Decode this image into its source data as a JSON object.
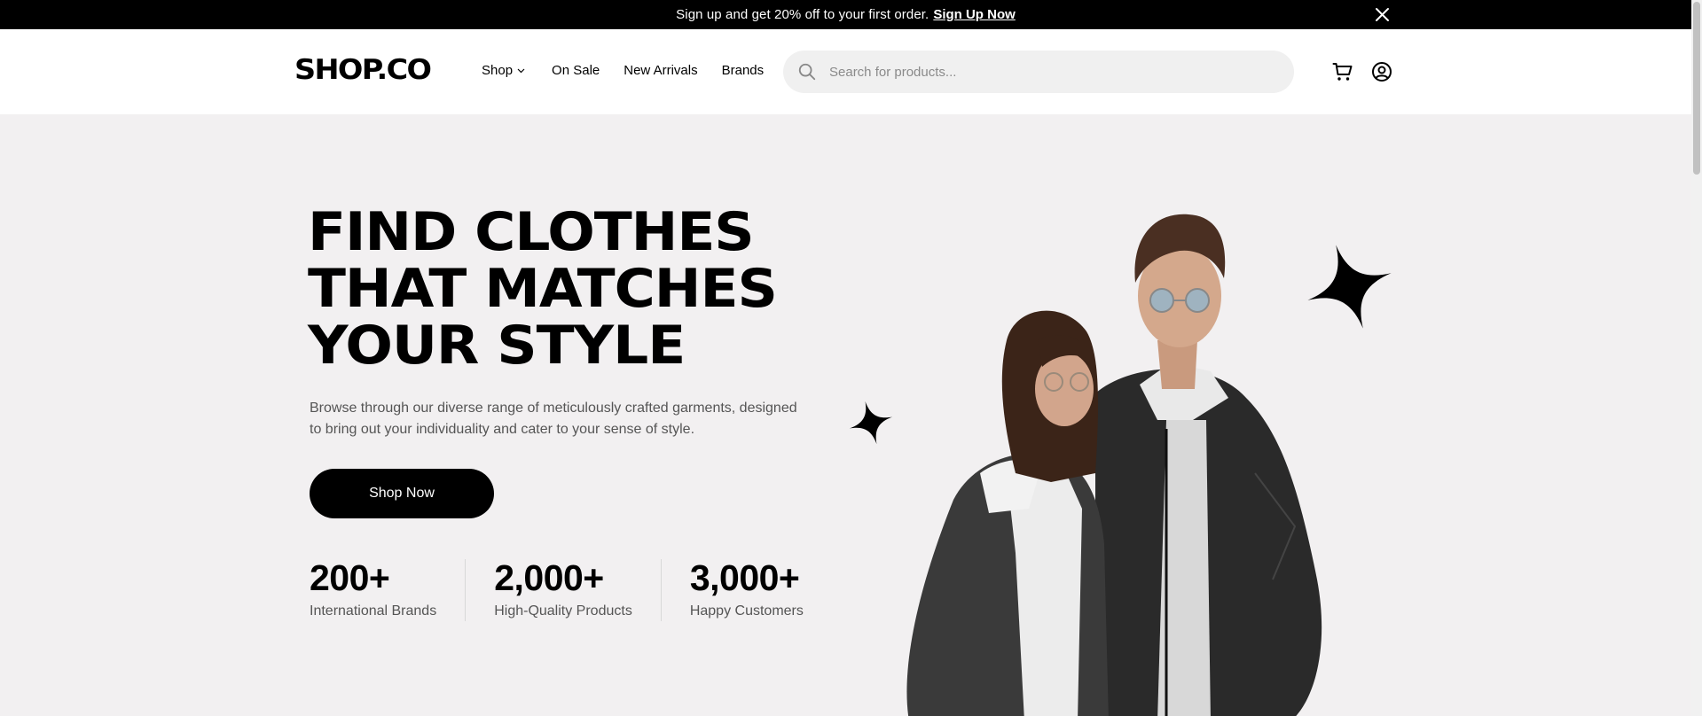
{
  "promo": {
    "text": "Sign up and get 20% off to your first order.",
    "link": "Sign Up Now"
  },
  "header": {
    "logo": "SHOP.CO",
    "nav": {
      "shop": "Shop",
      "on_sale": "On Sale",
      "new_arrivals": "New Arrivals",
      "brands": "Brands"
    },
    "search_placeholder": "Search for products..."
  },
  "hero": {
    "title_lines": [
      "FIND CLOTHES",
      "THAT MATCHES",
      "YOUR STYLE"
    ],
    "description": "Browse through our diverse range of meticulously crafted garments, designed to bring out your individuality and cater to your sense of style.",
    "cta": "Shop Now",
    "stats": [
      {
        "value": "200+",
        "label": "International Brands"
      },
      {
        "value": "2,000+",
        "label": "High-Quality Products"
      },
      {
        "value": "3,000+",
        "label": "Happy Customers"
      }
    ]
  },
  "colors": {
    "promo_bg": "#000000",
    "hero_bg": "#f2f0f1",
    "search_bg": "#f0f0f0",
    "cta_bg": "#000000"
  },
  "icons": [
    "close-icon",
    "chevron-down-icon",
    "search-icon",
    "cart-icon",
    "user-icon",
    "sparkle-star-icon"
  ]
}
